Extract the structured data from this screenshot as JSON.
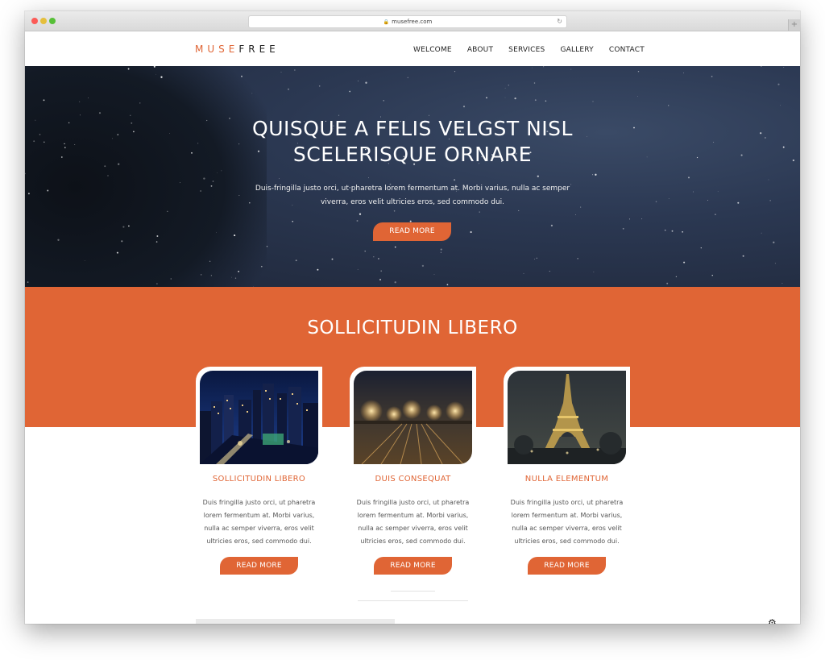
{
  "browser": {
    "url": "musefree.com"
  },
  "header": {
    "logo_part1": "MUSE",
    "logo_part2": "FREE",
    "nav": [
      "WELCOME",
      "ABOUT",
      "SERVICES",
      "GALLERY",
      "CONTACT"
    ]
  },
  "hero": {
    "title_line1": "QUISQUE A FELIS VELGST NISL",
    "title_line2": "SCELERISQUE ORNARE",
    "text_line1": "Duis-fringilla justo orci, ut pharetra lorem fermentum at. Morbi varius, nulla ac semper",
    "text_line2": "viverra, eros velit ultricies eros, sed commodo dui.",
    "button": "READ MORE"
  },
  "section": {
    "title": "SOLLICITUDIN LIBERO"
  },
  "cards": [
    {
      "title": "SOLLICITUDIN LIBERO",
      "lines": [
        "Duis fringilla justo orci, ut pharetra",
        "lorem fermentum at. Morbi varius,",
        "nulla ac semper viverra, eros velit",
        "ultricies eros, sed commodo dui."
      ],
      "button": "READ MORE"
    },
    {
      "title": "DUIS CONSEQUAT",
      "lines": [
        "Duis fringilla justo orci, ut pharetra",
        "lorem fermentum at. Morbi varius,",
        "nulla ac semper viverra, eros velit",
        "ultricies eros, sed commodo dui."
      ],
      "button": "READ MORE"
    },
    {
      "title": "NULLA ELEMENTUM",
      "lines": [
        "Duis fringilla justo orci, ut pharetra",
        "lorem fermentum at. Morbi varius,",
        "nulla ac semper viverra, eros velit",
        "ultricies eros, sed commodo dui."
      ],
      "button": "READ MORE"
    }
  ],
  "colors": {
    "accent": "#e06535",
    "hero_bg": "#2b3852",
    "text_dark": "#222222",
    "text_body": "#555555"
  },
  "icons": {
    "lock": "lock-icon",
    "reload": "reload-icon",
    "new_tab": "plus-icon",
    "settings": "gear-icon"
  }
}
